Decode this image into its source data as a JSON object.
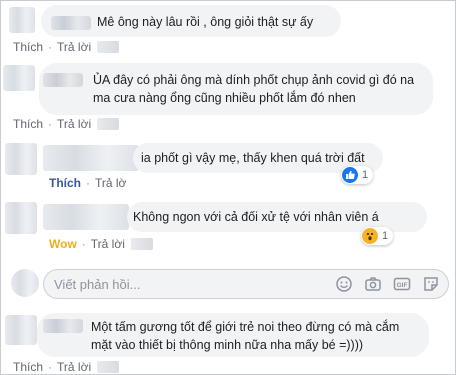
{
  "comments": [
    {
      "text": "Mê ông này lâu rồi , ông giỏi thật sự ấy",
      "like": "Thích",
      "reply": "Trả lời"
    },
    {
      "text": "ỦA đây có phải ông mà dính phốt chụp ảnh covid gì đó na ma cưa nàng ổng cũng nhiều phốt lắm đó nhen",
      "like": "Thích",
      "reply": "Trả lời"
    },
    {
      "text": "ia phốt gì vậy mẹ, thấy khen quá trời đất",
      "like": "Thích",
      "reply": "Trả lờ",
      "reaction": {
        "icon": "thumbs-up-icon",
        "count": "1"
      }
    },
    {
      "text": "Không ngon với cả đối xử tệ với nhân viên á",
      "like": "Wow",
      "reply": "Trả lời",
      "reaction": {
        "icon": "wow-face-icon",
        "count": "1"
      }
    },
    {
      "text": "Một tấm gương tốt để giới trẻ noi theo đừng có mà cắm mặt vào thiết bị thông minh nữa nha mấy bé =))))",
      "like": "Thích",
      "reply": "Trả lời"
    }
  ],
  "reply_box": {
    "placeholder": "Viết phản hồi...",
    "tools": [
      "emoji-icon",
      "camera-icon",
      "gif-icon",
      "sticker-icon"
    ]
  },
  "colors": {
    "like_active": "#385898",
    "wow": "#e8b11b",
    "bubble": "#f2f3f5",
    "muted": "#606770"
  }
}
